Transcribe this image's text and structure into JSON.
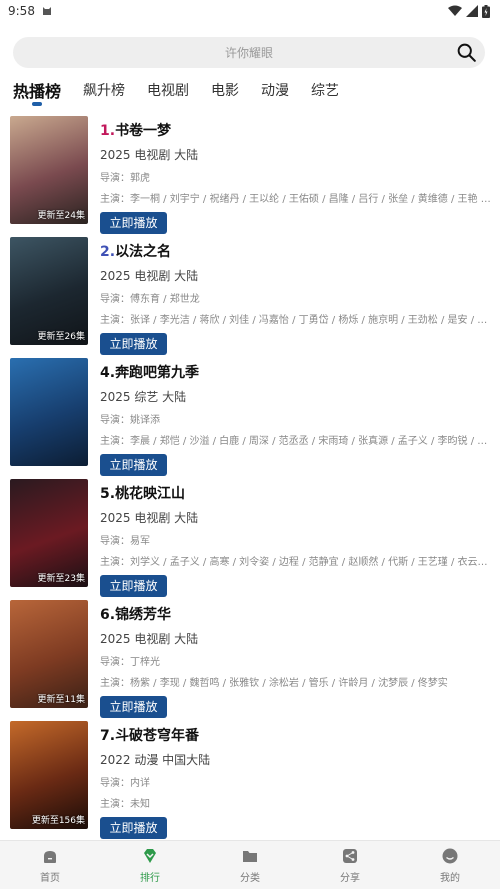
{
  "status": {
    "time": "9:58"
  },
  "search": {
    "placeholder": "许你耀眼"
  },
  "tabs": [
    {
      "label": "热播榜",
      "active": true
    },
    {
      "label": "飙升榜",
      "active": false
    },
    {
      "label": "电视剧",
      "active": false
    },
    {
      "label": "电影",
      "active": false
    },
    {
      "label": "动漫",
      "active": false
    },
    {
      "label": "综艺",
      "active": false
    }
  ],
  "items": [
    {
      "rank": "1.",
      "name": "书卷一梦",
      "meta": "2025  电视剧  大陆",
      "director": "导演：郭虎",
      "cast": "主演：李一桐 / 刘宇宁 / 祝绪丹 / 王以纶 / 王佑硕 / 昌隆 / 吕行 / 张垒 / 黄维德 / 王艳 / 郑...",
      "badge": "更新至24集",
      "button": "立即播放",
      "colors": [
        "#c9a98f",
        "#7a4a4f",
        "#2a2320"
      ]
    },
    {
      "rank": "2.",
      "name": "以法之名",
      "meta": "2025  电视剧  大陆",
      "director": "导演：傅东育 / 郑世龙",
      "cast": "主演：张译 / 李光洁 / 蒋欣 / 刘佳 / 冯嘉怡 / 丁勇岱 / 杨烁 / 施京明 / 王劲松 / 是安 / 任重...",
      "badge": "更新至26集",
      "button": "立即播放",
      "colors": [
        "#3d5563",
        "#1c2730",
        "#101418"
      ]
    },
    {
      "rank": "4.",
      "name": "奔跑吧第九季",
      "meta": "2025  综艺  大陆",
      "director": "导演：姚译添",
      "cast": "主演：李晨 / 郑恺 / 沙溢 / 白鹿 / 周深 / 范丞丞 / 宋雨琦 / 张真源 / 孟子义 / 李昀锐 / 敖瑞...",
      "badge": "",
      "button": "立即播放",
      "colors": [
        "#2a6fb0",
        "#173e6e",
        "#0c1d33"
      ]
    },
    {
      "rank": "5.",
      "name": "桃花映江山",
      "meta": "2025  电视剧  大陆",
      "director": "导演：易军",
      "cast": "主演：刘学义 / 孟子义 / 高寒 / 刘令姿 / 边程 / 范静宜 / 赵顺然 / 代斯 / 王艺瑾 / 衣云鹤 / 易...",
      "badge": "更新至23集",
      "button": "立即播放",
      "colors": [
        "#2a1a20",
        "#6b1a22",
        "#1a1014"
      ]
    },
    {
      "rank": "6.",
      "name": "锦绣芳华",
      "meta": "2025  电视剧  大陆",
      "director": "导演：丁梓光",
      "cast": "主演：杨紫 / 李现 / 魏哲鸣 / 张雅钦 / 涂松岩 / 管乐 / 许龄月 / 沈梦辰 / 佟梦实",
      "badge": "更新至11集",
      "button": "立即播放",
      "colors": [
        "#b8663a",
        "#7e3b22",
        "#3a2016"
      ]
    },
    {
      "rank": "7.",
      "name": "斗破苍穹年番",
      "meta": "2022  动漫  中国大陆",
      "director": "导演：内详",
      "cast": "主演：未知",
      "badge": "更新至156集",
      "button": "立即播放",
      "colors": [
        "#c46a2a",
        "#6a2a14",
        "#1a0c08"
      ]
    }
  ],
  "bottom_nav": [
    {
      "label": "首页",
      "icon": "home-icon",
      "active": false
    },
    {
      "label": "排行",
      "icon": "ranking-icon",
      "active": true
    },
    {
      "label": "分类",
      "icon": "category-folder-icon",
      "active": false
    },
    {
      "label": "分享",
      "icon": "share-icon",
      "active": false
    },
    {
      "label": "我的",
      "icon": "profile-icon",
      "active": false
    }
  ]
}
